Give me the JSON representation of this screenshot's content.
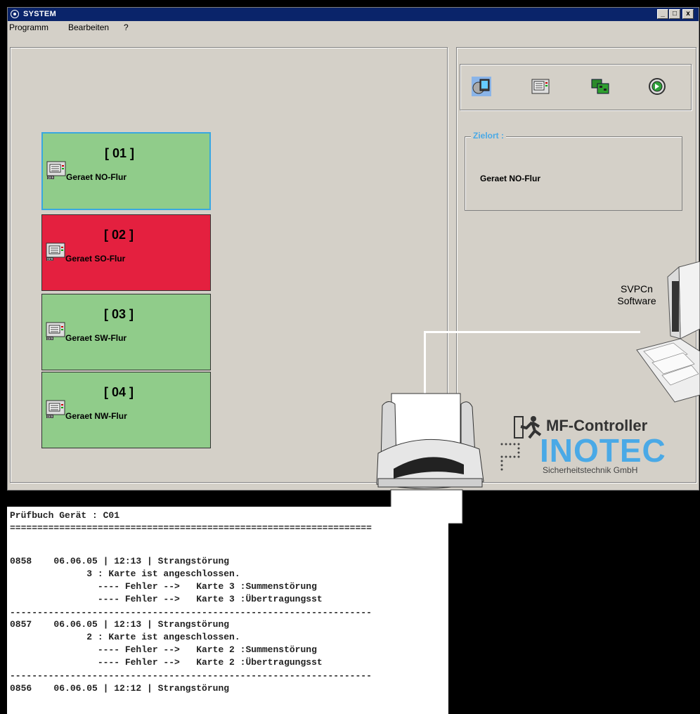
{
  "window": {
    "title": "SYSTEM",
    "buttons": [
      "_",
      "□",
      "x"
    ]
  },
  "menu": [
    "Programm",
    "Bearbeiten",
    "?"
  ],
  "devices": [
    {
      "num": "[ 01 ]",
      "name": "Geraet NO-Flur",
      "status": "ok",
      "color": "#90cc8a",
      "selected": true
    },
    {
      "num": "[ 02 ]",
      "name": "Geraet SO-Flur",
      "status": "error",
      "color": "#e4203f"
    },
    {
      "num": "[ 03 ]",
      "name": "Geraet SW-Flur",
      "status": "ok",
      "color": "#90cc8a"
    },
    {
      "num": "[ 04 ]",
      "name": "Geraet NW-Flur",
      "status": "ok",
      "color": "#90cc8a"
    }
  ],
  "device_icon_label": "DER",
  "toolbar": {
    "icons": [
      "monitor-icon",
      "device-icon",
      "network-card-icon",
      "next-icon"
    ]
  },
  "zielort": {
    "label": "Zielort :",
    "value": "Geraet NO-Flur"
  },
  "software": {
    "line1": "SVPCn",
    "line2": "Software"
  },
  "branding": {
    "product": "MF-Controller",
    "company": "INOTEC",
    "subtitle": "Sicherheitstechnik GmbH"
  },
  "log": {
    "lines": [
      "Prüfbuch Gerät : C01",
      "==================================================================",
      "",
      "0858    06.06.05 | 12:13 | Strangstörung",
      "              3 : Karte ist angeschlossen.",
      "                ---- Fehler -->   Karte 3 :Summenstörung",
      "                ---- Fehler -->   Karte 3 :Übertragungsst",
      "------------------------------------------------------------------",
      "0857    06.06.05 | 12:13 | Strangstörung",
      "              2 : Karte ist angeschlossen.",
      "                ---- Fehler -->   Karte 2 :Summenstörung",
      "                ---- Fehler -->   Karte 2 :Übertragungsst",
      "------------------------------------------------------------------",
      "0856    06.06.05 | 12:12 | Strangstörung"
    ]
  }
}
